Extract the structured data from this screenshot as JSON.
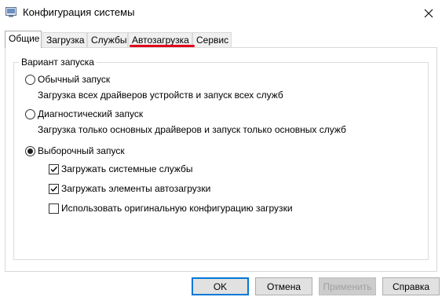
{
  "window": {
    "title": "Конфигурация системы",
    "icon": "msconfig-icon"
  },
  "tabs": [
    {
      "label": "Общие",
      "active": true
    },
    {
      "label": "Загрузка",
      "active": false
    },
    {
      "label": "Службы",
      "active": false
    },
    {
      "label": "Автозагрузка",
      "active": false,
      "highlighted": true
    },
    {
      "label": "Сервис",
      "active": false
    }
  ],
  "startup_group": {
    "label": "Вариант запуска",
    "options": [
      {
        "label": "Обычный запуск",
        "description": "Загрузка всех драйверов устройств и запуск всех служб",
        "selected": false
      },
      {
        "label": "Диагностический запуск",
        "description": "Загрузка только основных драйверов и запуск только основных служб",
        "selected": false
      },
      {
        "label": "Выборочный запуск",
        "description": "",
        "selected": true
      }
    ],
    "selective_options": [
      {
        "label": "Загружать системные службы",
        "checked": true
      },
      {
        "label": "Загружать элементы автозагрузки",
        "checked": true
      },
      {
        "label": "Использовать оригинальную конфигурацию загрузки",
        "checked": false
      }
    ]
  },
  "buttons": {
    "ok": "OK",
    "cancel": "Отмена",
    "apply": "Применить",
    "help": "Справка"
  },
  "colors": {
    "highlight_underline": "#e0001b",
    "default_button_border": "#0078d7"
  }
}
